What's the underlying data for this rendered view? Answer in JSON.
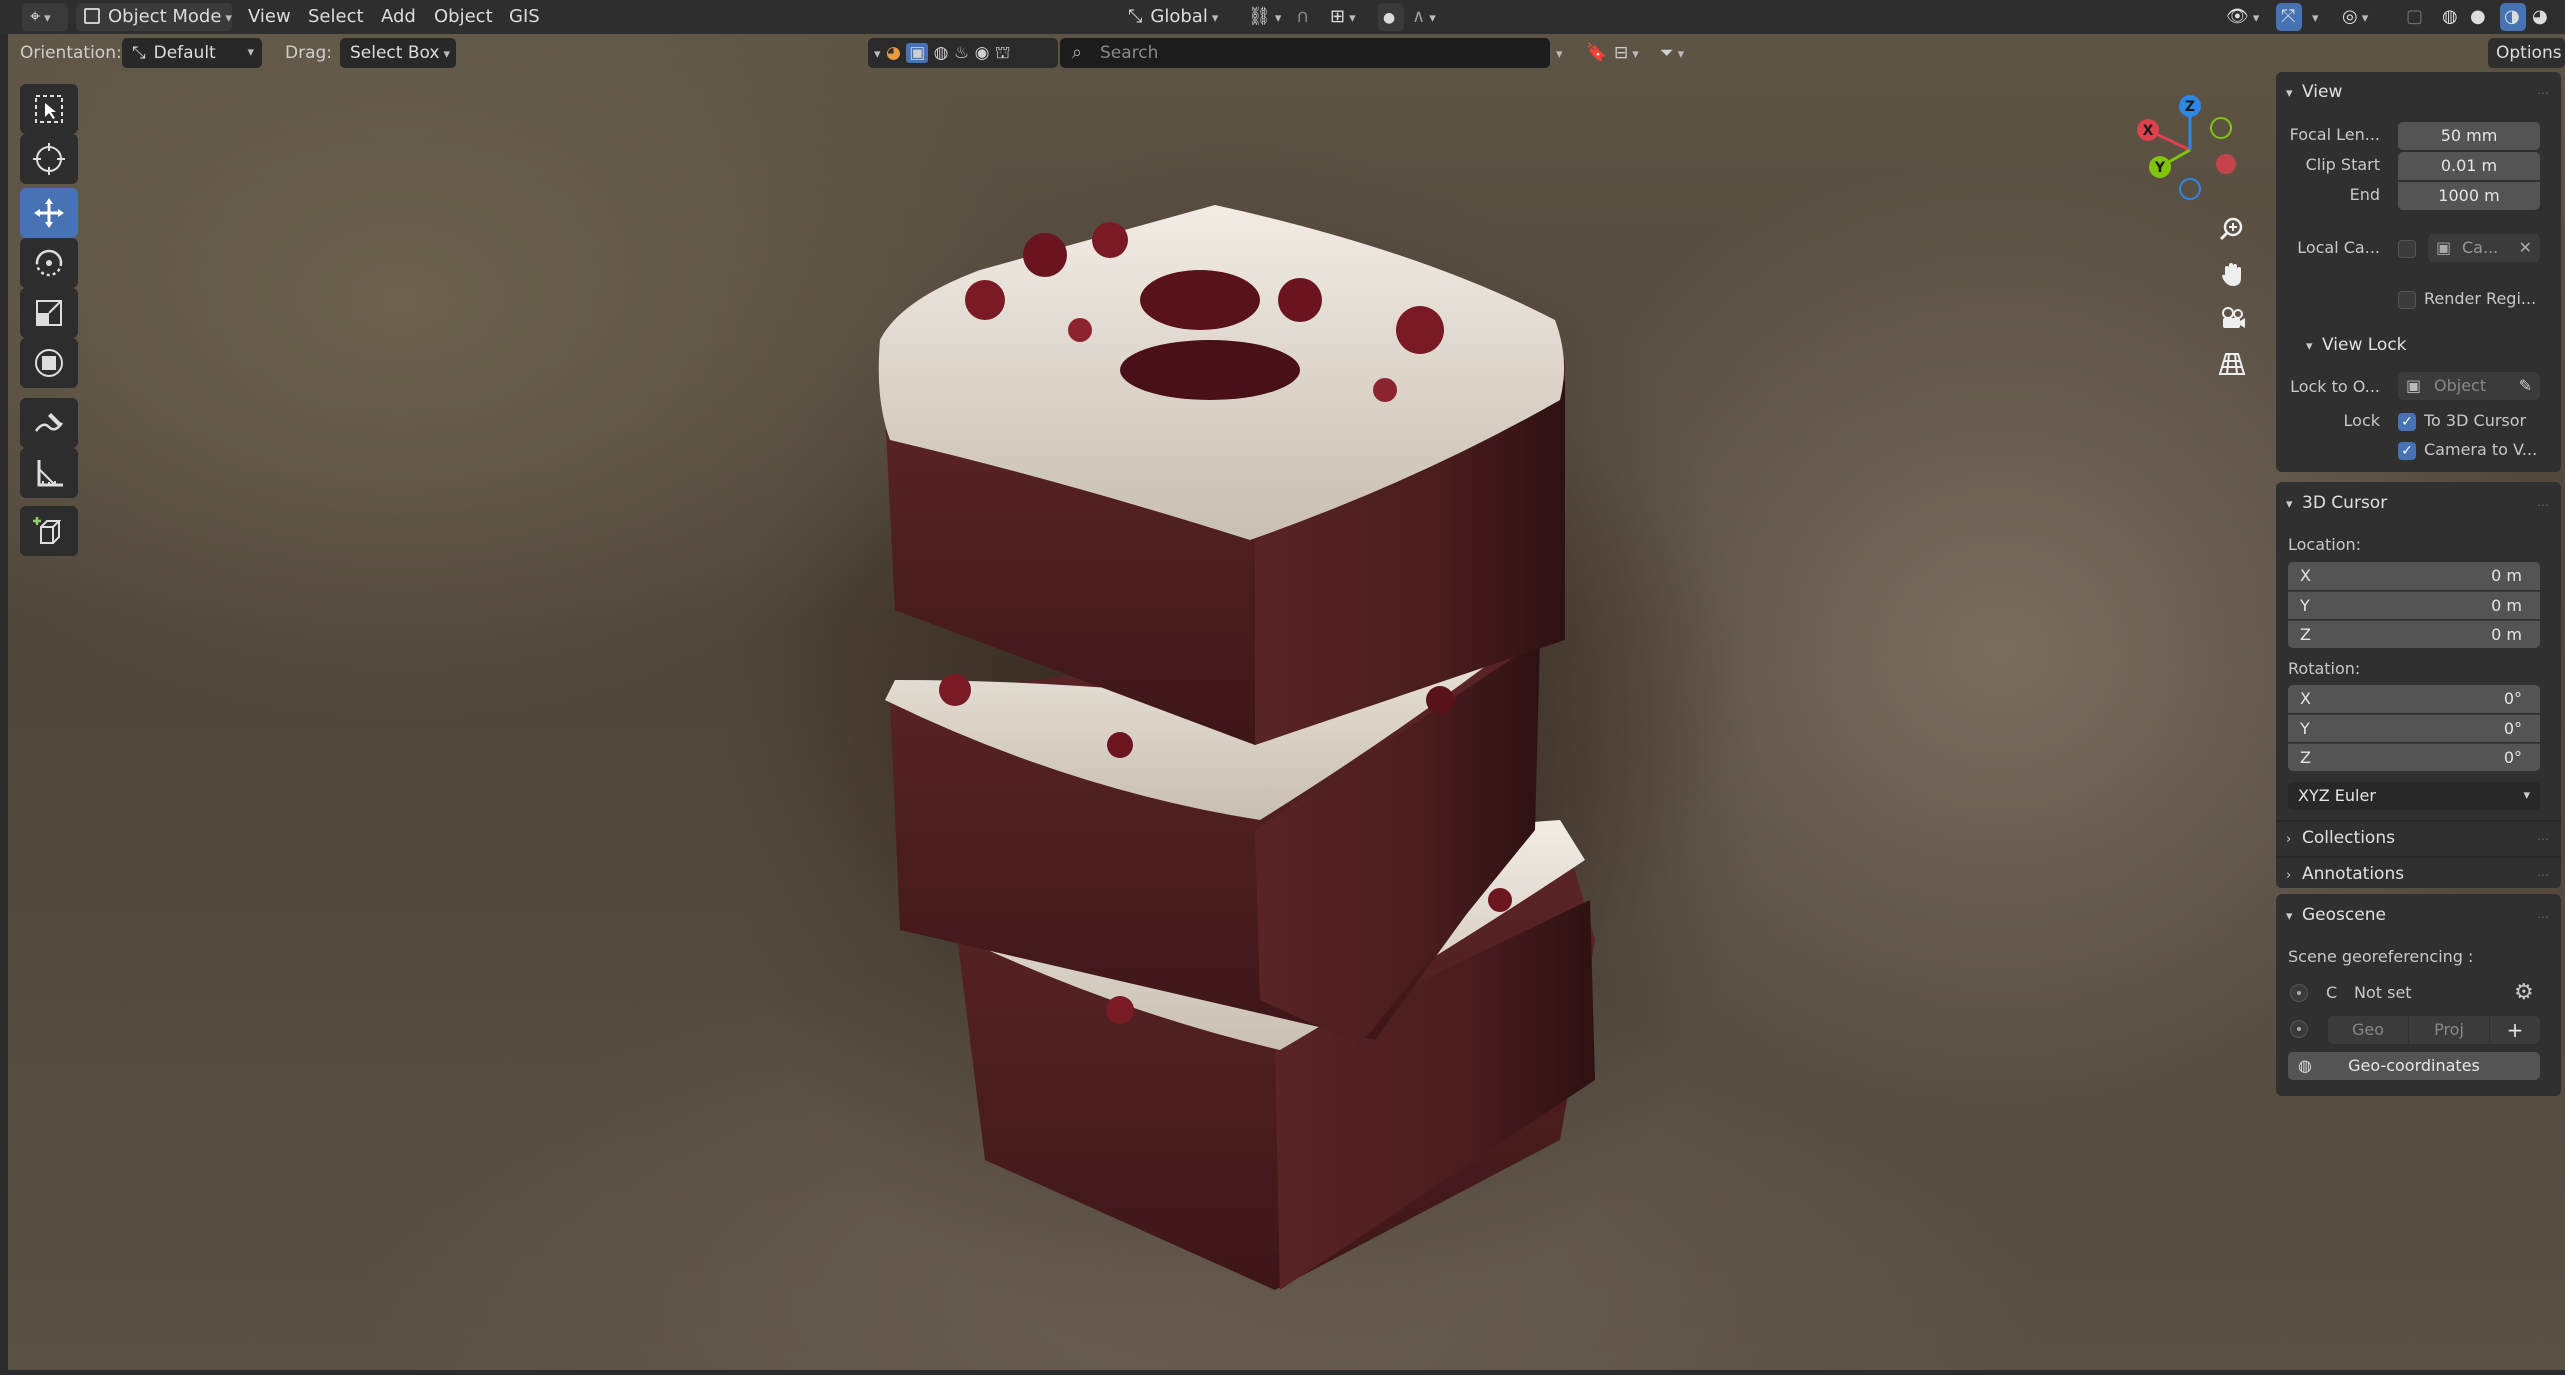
{
  "header": {
    "mode_label": "Object Mode",
    "menu": [
      "View",
      "Select",
      "Add",
      "Object",
      "GIS"
    ],
    "transform_orientation": "Global",
    "options_label": "Options"
  },
  "toolheader": {
    "orientation_label": "Orientation:",
    "orientation_value": "Default",
    "drag_label": "Drag:",
    "drag_value": "Select Box",
    "search_placeholder": "Search"
  },
  "gizmo": {
    "x_label": "X",
    "y_label": "Y",
    "z_label": "Z",
    "colors": {
      "x": "#e0414f",
      "y": "#82c40c",
      "z": "#2d87e6"
    }
  },
  "sidebar": {
    "view": {
      "title": "View",
      "focal_length_label": "Focal Len...",
      "focal_length_value": "50 mm",
      "clip_start_label": "Clip Start",
      "clip_start_value": "0.01 m",
      "clip_end_label": "End",
      "clip_end_value": "1000 m",
      "local_camera_label": "Local Ca...",
      "local_camera_value": "Ca...",
      "render_region_label": "Render Regi...",
      "view_lock": {
        "title": "View Lock",
        "lock_to_object_label": "Lock to O...",
        "lock_to_object_placeholder": "Object",
        "lock_label": "Lock",
        "to_3d_cursor_label": "To 3D Cursor",
        "camera_to_view_label": "Camera to V..."
      }
    },
    "cursor": {
      "title": "3D Cursor",
      "location_label": "Location:",
      "location": [
        {
          "axis": "X",
          "value": "0 m"
        },
        {
          "axis": "Y",
          "value": "0 m"
        },
        {
          "axis": "Z",
          "value": "0 m"
        }
      ],
      "rotation_label": "Rotation:",
      "rotation": [
        {
          "axis": "X",
          "value": "0°"
        },
        {
          "axis": "Y",
          "value": "0°"
        },
        {
          "axis": "Z",
          "value": "0°"
        }
      ],
      "rotation_mode": "XYZ Euler"
    },
    "collections_title": "Collections",
    "annotations_title": "Annotations",
    "geoscene": {
      "title": "Geoscene",
      "georef_label": "Scene georeferencing :",
      "crs_letter": "C",
      "crs_value": "Not set",
      "geo_label": "Geo",
      "proj_label": "Proj",
      "geocoords_button": "Geo-coordinates"
    }
  },
  "colors": {
    "accent": "#4772b3",
    "panel_bg": "#303030",
    "header_bg": "#2e2e2e"
  }
}
